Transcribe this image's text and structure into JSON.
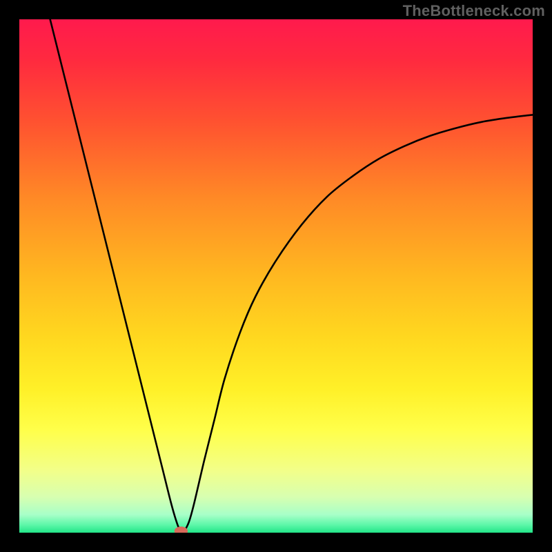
{
  "watermark": "TheBottleneck.com",
  "chart_data": {
    "type": "line",
    "title": "",
    "xlabel": "",
    "ylabel": "",
    "xlim": [
      0,
      100
    ],
    "ylim": [
      0,
      100
    ],
    "background_gradient_stops": [
      {
        "offset": 0,
        "color": "#ff1a4d"
      },
      {
        "offset": 0.08,
        "color": "#ff2a3f"
      },
      {
        "offset": 0.2,
        "color": "#ff5230"
      },
      {
        "offset": 0.35,
        "color": "#ff8a26"
      },
      {
        "offset": 0.5,
        "color": "#ffb820"
      },
      {
        "offset": 0.62,
        "color": "#ffd81f"
      },
      {
        "offset": 0.72,
        "color": "#fff028"
      },
      {
        "offset": 0.8,
        "color": "#ffff4a"
      },
      {
        "offset": 0.88,
        "color": "#f2ff8a"
      },
      {
        "offset": 0.93,
        "color": "#d8ffb0"
      },
      {
        "offset": 0.965,
        "color": "#a8ffc8"
      },
      {
        "offset": 0.985,
        "color": "#5cf7a8"
      },
      {
        "offset": 1.0,
        "color": "#22e588"
      }
    ],
    "series": [
      {
        "name": "bottleneck-curve",
        "color": "#000000",
        "x": [
          6,
          8,
          10,
          12,
          14,
          16,
          18,
          20,
          22,
          24,
          26,
          28,
          29.5,
          30.5,
          31.2,
          32.0,
          33.0,
          34.0,
          36,
          38,
          40,
          43,
          46,
          50,
          55,
          60,
          65,
          70,
          75,
          80,
          85,
          90,
          95,
          100
        ],
        "y": [
          100,
          92,
          84,
          76,
          68,
          60,
          52,
          44,
          36,
          28,
          20,
          12,
          6,
          2.5,
          0.7,
          0.3,
          2.0,
          5.5,
          14,
          22,
          30,
          39,
          46,
          53,
          60,
          65.5,
          69.5,
          72.8,
          75.3,
          77.3,
          78.8,
          80.0,
          80.8,
          81.4
        ]
      }
    ],
    "marker": {
      "x": 31.5,
      "y": 0.3,
      "rx": 1.3,
      "ry": 0.9,
      "color": "#d86a5a"
    }
  }
}
